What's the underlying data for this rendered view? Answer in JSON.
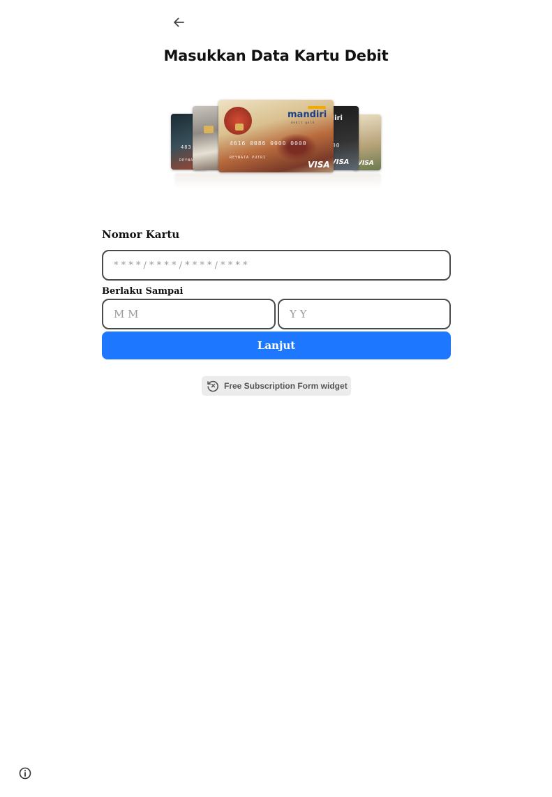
{
  "header": {
    "back_icon": "arrow-left-icon",
    "title": "Masukkan Data Kartu Debit"
  },
  "card_image": {
    "brand": "mandiri",
    "subtitle": "debit gold",
    "card_number": "4616 0086 0000 0000",
    "holder": "REYNATA PUTRI",
    "network": "VISA"
  },
  "form": {
    "card_number_label": "Nomor Kartu",
    "card_number_placeholder": "* * * * / * * * * / * * * * / * * * *",
    "expiry_label": "Berlaku Sampai",
    "month_placeholder": "M M",
    "year_placeholder": "Y Y",
    "submit_label": "Lanjut"
  },
  "widget_badge": {
    "icon": "history-icon",
    "text": "Free Subscription Form widget"
  },
  "footer": {
    "info_icon": "info-icon"
  },
  "colors": {
    "primary": "#1e78ff",
    "input_border": "#4a4a4a",
    "badge_bg": "#ececec"
  }
}
